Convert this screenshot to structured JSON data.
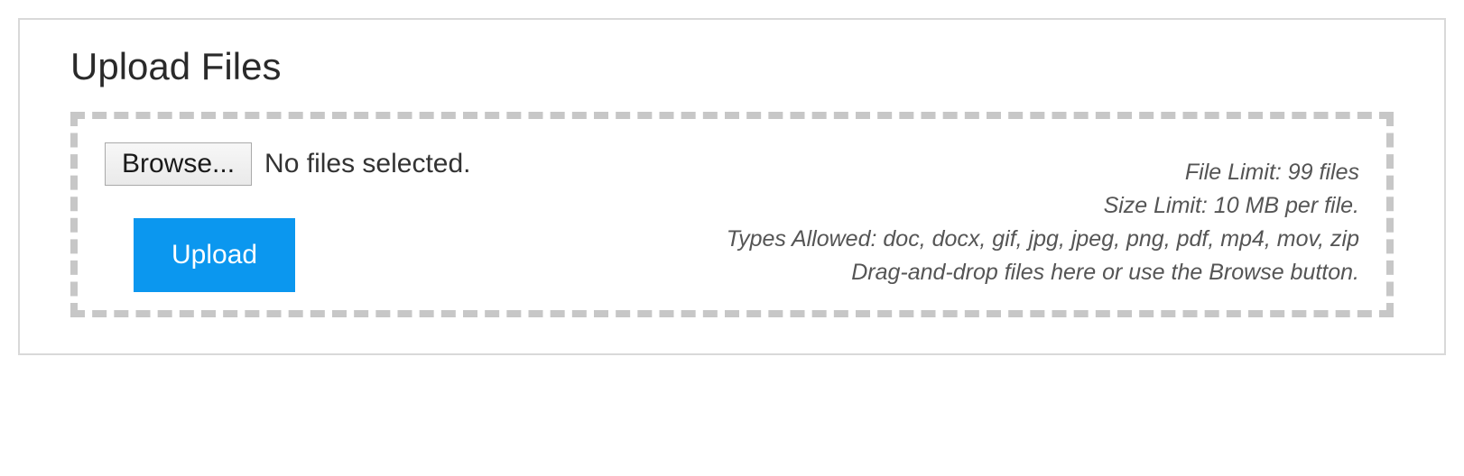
{
  "panel": {
    "title": "Upload Files"
  },
  "fileInput": {
    "browseLabel": "Browse...",
    "statusText": "No files selected."
  },
  "actions": {
    "uploadLabel": "Upload"
  },
  "hints": {
    "fileLimit": "File Limit: 99 files",
    "sizeLimit": "Size Limit: 10 MB per file.",
    "typesAllowed": "Types Allowed: doc, docx, gif, jpg, jpeg, png, pdf, mp4, mov, zip",
    "dragDrop": "Drag-and-drop files here or use the Browse button."
  }
}
